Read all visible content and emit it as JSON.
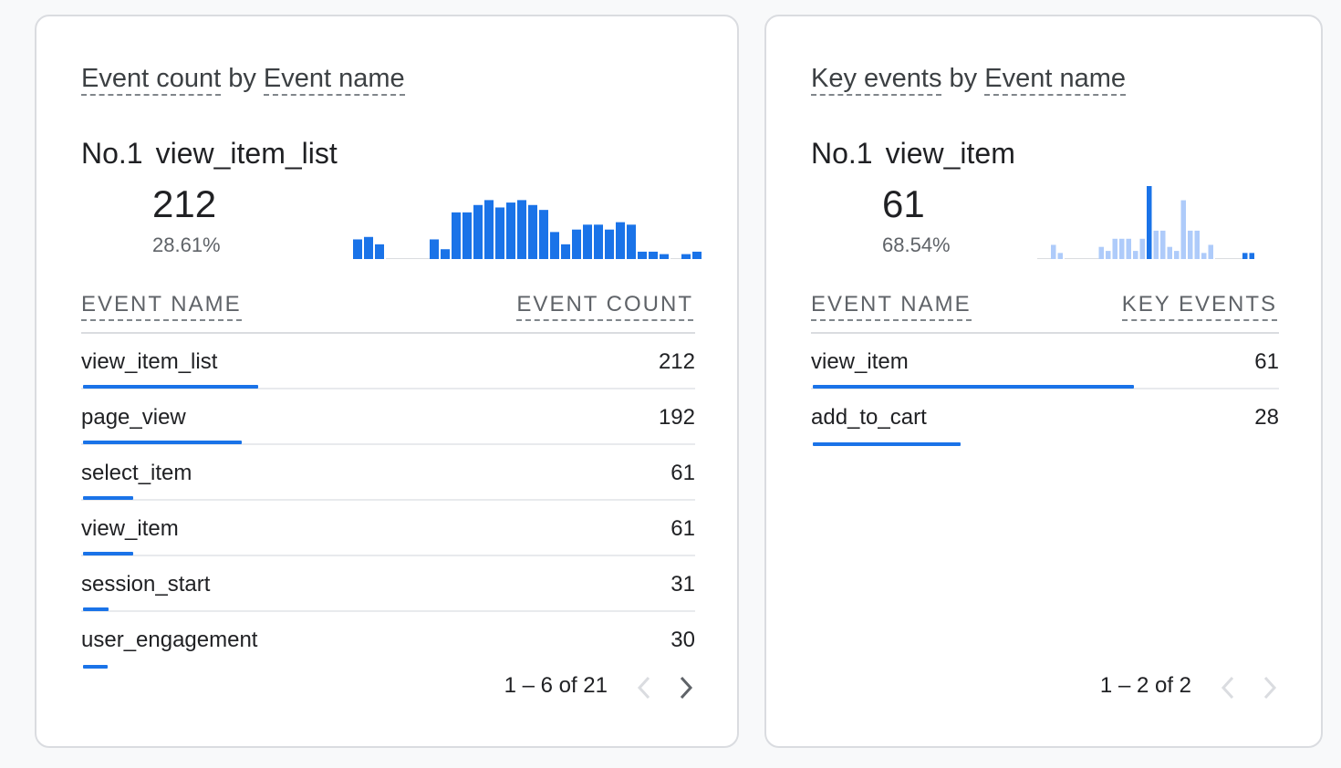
{
  "colors": {
    "accent": "#1a73e8",
    "accent_light": "#aecbfa",
    "baseline": "#dadce0",
    "icon_disabled": "#dadce0",
    "icon_enabled": "#5f6368"
  },
  "cards": [
    {
      "title_metric": "Event count",
      "title_by": "by",
      "title_dimension": "Event name",
      "rank_label": "No.1",
      "rank_name": "view_item_list",
      "big_value": "212",
      "big_pct": "28.61%",
      "col_left": "EVENT NAME",
      "col_right": "EVENT COUNT",
      "rows": [
        {
          "name": "view_item_list",
          "value": "212",
          "share": 1.0
        },
        {
          "name": "page_view",
          "value": "192",
          "share": 0.906
        },
        {
          "name": "select_item",
          "value": "61",
          "share": 0.288
        },
        {
          "name": "view_item",
          "value": "61",
          "share": 0.288
        },
        {
          "name": "session_start",
          "value": "31",
          "share": 0.146
        },
        {
          "name": "user_engagement",
          "value": "30",
          "share": 0.142
        }
      ],
      "pager": "1 – 6 of 21",
      "prev_icon": "chevron-left-icon",
      "next_icon": "chevron-right-icon",
      "prev_enabled": false,
      "next_enabled": true,
      "chart_data": {
        "type": "bar",
        "series": [
          {
            "values": [
              8,
              9,
              6,
              0,
              0,
              0,
              0,
              8,
              4,
              19,
              19,
              22,
              24,
              21,
              23,
              24,
              22,
              20,
              11,
              6,
              12,
              14,
              14,
              12,
              15,
              14,
              3,
              3,
              2,
              0,
              2,
              3
            ],
            "highlight": true
          }
        ],
        "ylim": [
          0,
          26
        ]
      }
    },
    {
      "title_metric": "Key events",
      "title_by": "by",
      "title_dimension": "Event name",
      "rank_label": "No.1",
      "rank_name": "view_item",
      "big_value": "61",
      "big_pct": "68.54%",
      "col_left": "EVENT NAME",
      "col_right": "KEY EVENTS",
      "rows": [
        {
          "name": "view_item",
          "value": "61",
          "share": 1.0
        },
        {
          "name": "add_to_cart",
          "value": "28",
          "share": 0.459
        }
      ],
      "pager": "1 – 2 of 2",
      "prev_icon": "chevron-left-icon",
      "next_icon": "chevron-right-icon",
      "prev_enabled": false,
      "next_enabled": false,
      "chart_data": {
        "type": "bar",
        "series": [
          {
            "values": [
              0,
              0,
              7,
              3,
              0,
              0,
              0,
              0,
              0,
              6,
              4,
              10,
              10,
              10,
              4,
              10,
              36,
              14,
              14,
              6,
              4,
              29,
              14,
              14,
              3,
              7,
              0,
              0,
              0,
              0,
              3,
              3
            ],
            "highlight_index": 16,
            "dark_indices": [
              30,
              31
            ]
          }
        ],
        "ylim": [
          0,
          36
        ]
      }
    }
  ]
}
